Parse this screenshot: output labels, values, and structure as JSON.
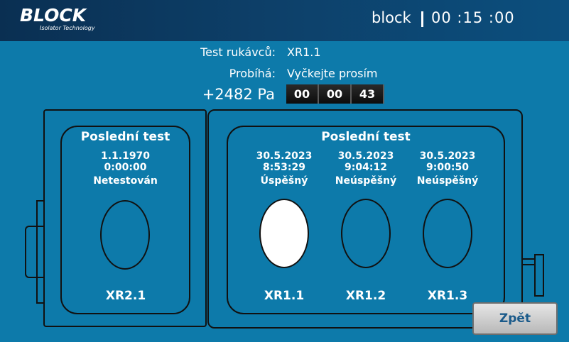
{
  "header": {
    "logo_main": "BLOCK",
    "logo_sub": "Isolator Technology",
    "user": "block",
    "clock": "00 :15 :00"
  },
  "status": {
    "test_label": "Test rukávců:",
    "test_value": "XR1.1",
    "running_label": "Probíhá:",
    "running_value": "Vyčkejte prosím",
    "pressure": "+2482 Pa",
    "timer": [
      "00",
      "00",
      "43"
    ]
  },
  "left_panel": {
    "title": "Poslední test",
    "gloves": [
      {
        "date": "1.1.1970",
        "time": "0:00:00",
        "result": "Netestován",
        "name": "XR2.1",
        "passed": false
      }
    ]
  },
  "right_panel": {
    "title": "Poslední test",
    "gloves": [
      {
        "date": "30.5.2023",
        "time": "8:53:29",
        "result": "Úspěšný",
        "name": "XR1.1",
        "passed": true
      },
      {
        "date": "30.5.2023",
        "time": "9:04:12",
        "result": "Neúspěšný",
        "name": "XR1.2",
        "passed": false
      },
      {
        "date": "30.5.2023",
        "time": "9:00:50",
        "result": "Neúspěšný",
        "name": "XR1.3",
        "passed": false
      }
    ]
  },
  "actions": {
    "back_label": "Zpět"
  }
}
